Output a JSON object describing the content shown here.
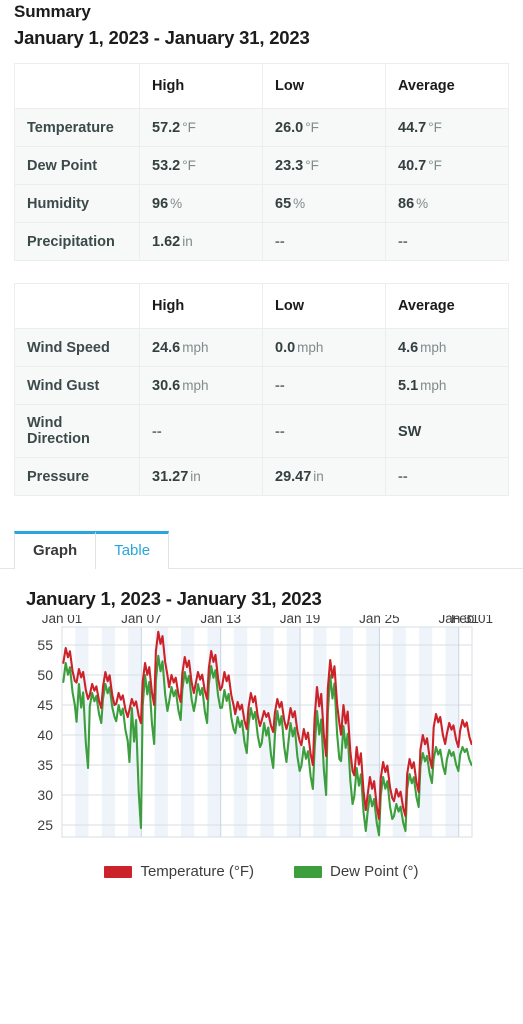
{
  "header": {
    "title": "Summary",
    "date_range": "January 1, 2023 - January 31, 2023"
  },
  "tables": [
    {
      "name": "conditions-table",
      "columns": [
        "",
        "High",
        "Low",
        "Average"
      ],
      "rows": [
        {
          "label": "Temperature",
          "high": {
            "value": "57.2",
            "unit": "°F"
          },
          "low": {
            "value": "26.0",
            "unit": "°F"
          },
          "average": {
            "value": "44.7",
            "unit": "°F"
          }
        },
        {
          "label": "Dew Point",
          "high": {
            "value": "53.2",
            "unit": "°F"
          },
          "low": {
            "value": "23.3",
            "unit": "°F"
          },
          "average": {
            "value": "40.7",
            "unit": "°F"
          }
        },
        {
          "label": "Humidity",
          "high": {
            "value": "96",
            "unit": "%"
          },
          "low": {
            "value": "65",
            "unit": "%"
          },
          "average": {
            "value": "86",
            "unit": "%"
          }
        },
        {
          "label": "Precipitation",
          "high": {
            "value": "1.62",
            "unit": "in"
          },
          "low": {
            "value": "--",
            "unit": ""
          },
          "average": {
            "value": "--",
            "unit": ""
          }
        }
      ]
    },
    {
      "name": "wind-table",
      "columns": [
        "",
        "High",
        "Low",
        "Average"
      ],
      "rows": [
        {
          "label": "Wind Speed",
          "high": {
            "value": "24.6",
            "unit": "mph"
          },
          "low": {
            "value": "0.0",
            "unit": "mph"
          },
          "average": {
            "value": "4.6",
            "unit": "mph"
          }
        },
        {
          "label": "Wind Gust",
          "high": {
            "value": "30.6",
            "unit": "mph"
          },
          "low": {
            "value": "--",
            "unit": ""
          },
          "average": {
            "value": "5.1",
            "unit": "mph"
          }
        },
        {
          "label": "Wind Direction",
          "high": {
            "value": "--",
            "unit": ""
          },
          "low": {
            "value": "--",
            "unit": ""
          },
          "average": {
            "value": "SW",
            "unit": ""
          }
        },
        {
          "label": "Pressure",
          "high": {
            "value": "31.27",
            "unit": "in"
          },
          "low": {
            "value": "29.47",
            "unit": "in"
          },
          "average": {
            "value": "--",
            "unit": ""
          }
        }
      ]
    }
  ],
  "tabs": {
    "items": [
      {
        "label": "Graph",
        "active": true
      },
      {
        "label": "Table",
        "active": false
      }
    ],
    "accent_color": "#29a6dd"
  },
  "chart_data": {
    "type": "line",
    "title": "January 1, 2023 - January 31, 2023",
    "xlabel": "",
    "ylabel": "",
    "grid": true,
    "legend_position": "bottom",
    "ylim": [
      23,
      58
    ],
    "yticks": [
      25,
      30,
      35,
      40,
      45,
      50,
      55
    ],
    "xtick_labels": [
      "Jan 01",
      "Jan 07",
      "Jan 13",
      "Jan 19",
      "Jan 25",
      "Jan 31",
      "Feb 01"
    ],
    "xtick_days": [
      1,
      7,
      13,
      19,
      25,
      31,
      32
    ],
    "x": [
      1,
      2,
      3,
      4,
      5,
      6,
      7,
      8,
      9,
      10,
      11,
      12,
      13,
      14,
      15,
      16,
      17,
      18,
      19,
      20,
      21,
      22,
      23,
      24,
      25,
      26,
      27,
      28,
      29,
      30,
      31
    ],
    "series": [
      {
        "name": "Temperature (°F)",
        "color": "#cc2229",
        "unit": "°F",
        "values": [
          54.5,
          51.0,
          48.5,
          50.5,
          47.0,
          46.0,
          52.0,
          57.2,
          50.0,
          53.0,
          50.5,
          54.0,
          50.5,
          45.5,
          47.0,
          44.0,
          46.0,
          44.5,
          41.0,
          48.0,
          52.5,
          45.0,
          38.0,
          33.0,
          35.5,
          31.0,
          36.0,
          40.0,
          43.5,
          42.0,
          42.5
        ],
        "daily_min": [
          49.0,
          46.0,
          44.5,
          45.0,
          43.0,
          42.0,
          45.0,
          50.0,
          45.5,
          47.0,
          46.0,
          47.5,
          45.0,
          41.0,
          41.5,
          40.5,
          41.0,
          39.0,
          35.0,
          36.5,
          42.0,
          34.0,
          27.5,
          26.0,
          29.5,
          26.5,
          30.5,
          34.5,
          38.5,
          38.0,
          38.5
        ]
      },
      {
        "name": "Dew Point (°)",
        "color": "#3c9e3c",
        "unit": "°",
        "values": [
          52.0,
          48.5,
          47.0,
          48.5,
          45.0,
          44.5,
          50.0,
          53.2,
          48.0,
          50.5,
          48.5,
          51.5,
          47.5,
          43.0,
          44.5,
          42.0,
          44.0,
          42.0,
          38.0,
          44.0,
          50.0,
          41.5,
          34.5,
          30.0,
          33.0,
          28.5,
          33.5,
          37.0,
          38.0,
          37.5,
          38.0
        ],
        "daily_min": [
          45.0,
          34.5,
          42.0,
          43.0,
          39.0,
          24.5,
          38.5,
          44.0,
          42.5,
          44.0,
          42.0,
          44.5,
          41.0,
          37.0,
          38.0,
          34.5,
          35.5,
          34.0,
          31.0,
          30.0,
          36.0,
          28.5,
          24.0,
          23.3,
          26.0,
          24.0,
          28.0,
          32.0,
          33.5,
          34.0,
          35.0
        ]
      }
    ]
  }
}
